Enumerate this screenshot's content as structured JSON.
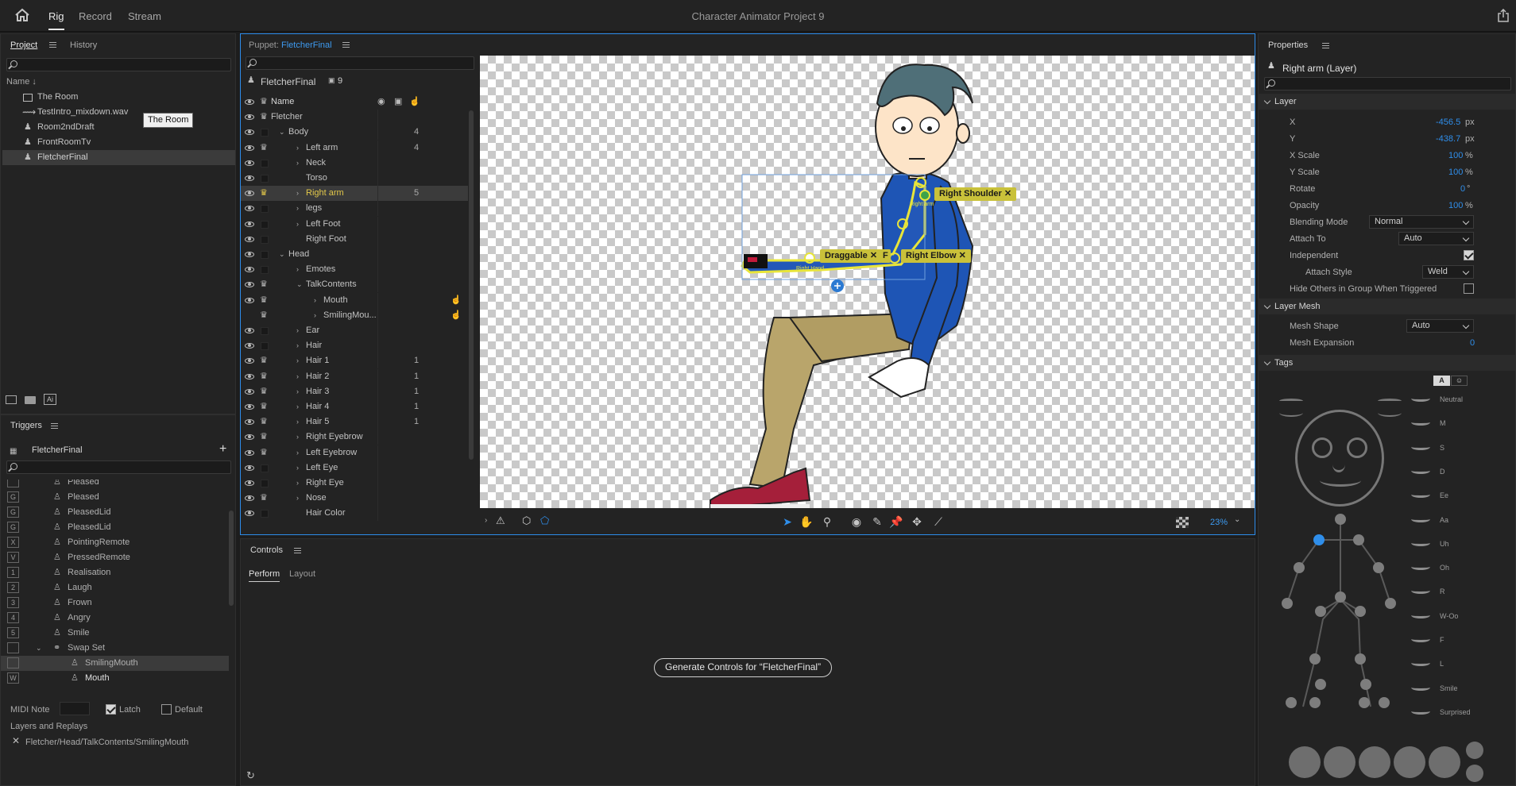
{
  "app": {
    "title": "Character Animator Project 9",
    "tabs": [
      "Rig",
      "Record",
      "Stream"
    ]
  },
  "project": {
    "tabs": [
      "Project",
      "History"
    ],
    "col_name": "Name ↓",
    "items": [
      "The Room",
      "TestIntro_mixdown.wav",
      "Room2ndDraft",
      "FrontRoomTv",
      "FletcherFinal"
    ],
    "tooltip": "The Room"
  },
  "triggers": {
    "title": "Triggers",
    "puppet": "FletcherFinal",
    "items": [
      {
        "key": "",
        "label": "Pleased"
      },
      {
        "key": "G",
        "label": "Pleased"
      },
      {
        "key": "G",
        "label": "PleasedLid"
      },
      {
        "key": "G",
        "label": "PleasedLid"
      },
      {
        "key": "X",
        "label": "PointingRemote"
      },
      {
        "key": "V",
        "label": "PressedRemote"
      },
      {
        "key": "1",
        "label": "Realisation"
      },
      {
        "key": "2",
        "label": "Laugh"
      },
      {
        "key": "3",
        "label": "Frown"
      },
      {
        "key": "4",
        "label": "Angry"
      },
      {
        "key": "5",
        "label": "Smile"
      },
      {
        "key": "",
        "label": "Swap Set"
      },
      {
        "key": "",
        "label": "SmilingMouth"
      },
      {
        "key": "W",
        "label": "Mouth"
      }
    ],
    "midi_label": "MIDI Note",
    "latch": "Latch",
    "default": "Default",
    "layers_label": "Layers and Replays",
    "layer_path": "Fletcher/Head/TalkContents/SmilingMouth"
  },
  "puppet": {
    "prefix": "Puppet:",
    "name": "FletcherFinal",
    "root": "FletcherFinal",
    "count": "9",
    "col_name": "Name",
    "rows": [
      {
        "label": "Fletcher",
        "num": ""
      },
      {
        "label": "Body",
        "num": "4"
      },
      {
        "label": "Left arm",
        "num": "4"
      },
      {
        "label": "Neck",
        "num": ""
      },
      {
        "label": "Torso",
        "num": ""
      },
      {
        "label": "Right arm",
        "num": "5"
      },
      {
        "label": "legs",
        "num": ""
      },
      {
        "label": "Left Foot",
        "num": ""
      },
      {
        "label": "Right Foot",
        "num": ""
      },
      {
        "label": "Head",
        "num": ""
      },
      {
        "label": "Emotes",
        "num": ""
      },
      {
        "label": "TalkContents",
        "num": ""
      },
      {
        "label": "Mouth",
        "num": ""
      },
      {
        "label": "SmilingMou...",
        "num": ""
      },
      {
        "label": "Ear",
        "num": ""
      },
      {
        "label": "Hair",
        "num": ""
      },
      {
        "label": "Hair 1",
        "num": "1"
      },
      {
        "label": "Hair 2",
        "num": "1"
      },
      {
        "label": "Hair 3",
        "num": "1"
      },
      {
        "label": "Hair 4",
        "num": "1"
      },
      {
        "label": "Hair 5",
        "num": "1"
      },
      {
        "label": "Right Eyebrow",
        "num": ""
      },
      {
        "label": "Left Eyebrow",
        "num": ""
      },
      {
        "label": "Left Eye",
        "num": ""
      },
      {
        "label": "Right Eye",
        "num": ""
      },
      {
        "label": "Nose",
        "num": ""
      },
      {
        "label": "Hair Color",
        "num": ""
      }
    ]
  },
  "canvas": {
    "tags": {
      "shoulder": "Right Shoulder",
      "draggable": "Draggable",
      "elbow": "Right Elbow",
      "f": "F"
    },
    "small": {
      "rightarm": "Right arm",
      "head": "Right Hand"
    },
    "zoom": "23%"
  },
  "controls": {
    "title": "Controls",
    "tabs": [
      "Perform",
      "Layout"
    ],
    "generate": "Generate Controls for “FletcherFinal”"
  },
  "properties": {
    "title": "Properties",
    "layer_name": "Right arm (Layer)",
    "section_layer": "Layer",
    "x_label": "X",
    "x_val": "-456.5",
    "x_unit": "px",
    "y_label": "Y",
    "y_val": "-438.7",
    "y_unit": "px",
    "xs_label": "X Scale",
    "xs_val": "100",
    "xs_unit": "%",
    "ys_label": "Y Scale",
    "ys_val": "100",
    "ys_unit": "%",
    "rot_label": "Rotate",
    "rot_val": "0",
    "rot_unit": "°",
    "op_label": "Opacity",
    "op_val": "100",
    "op_unit": "%",
    "blend_label": "Blending Mode",
    "blend_val": "Normal",
    "attach_label": "Attach To",
    "attach_val": "Auto",
    "indep_label": "Independent",
    "style_label": "Attach Style",
    "style_val": "Weld",
    "hide_label": "Hide Others in Group When Triggered",
    "section_mesh": "Layer Mesh",
    "mesh_shape_label": "Mesh Shape",
    "mesh_shape_val": "Auto",
    "mesh_exp_label": "Mesh Expansion",
    "mesh_exp_val": "0",
    "section_tags": "Tags",
    "tag_toggle": "A",
    "visemes": [
      "Neutral",
      "M",
      "S",
      "D",
      "Ee",
      "Aa",
      "Uh",
      "Oh",
      "R",
      "W-Oo",
      "F",
      "L",
      "Smile",
      "Surprised"
    ]
  }
}
